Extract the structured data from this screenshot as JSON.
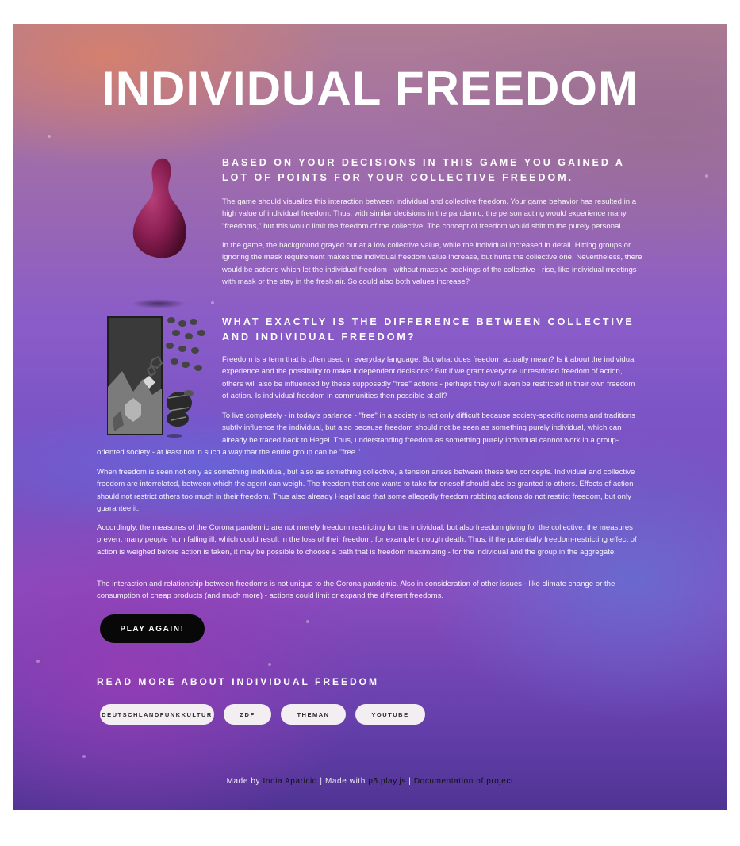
{
  "page": {
    "title": "INDIVIDUAL FREEDOM"
  },
  "section1": {
    "heading": "BASED ON YOUR DECISIONS IN THIS GAME YOU GAINED A LOT OF POINTS FOR YOUR COLLECTIVE FREEDOM.",
    "paragraphs": [
      "The game should visualize this interaction between individual and collective freedom. Your game behavior has resulted in a high value of individual freedom. Thus, with similar decisions in the pandemic, the person acting would experience many \"freedoms,\" but this would limit the freedom of the collective. The concept of freedom would shift to the purely personal.",
      "In the game, the background grayed out at a low collective value, while the individual increased in detail. Hitting groups or ignoring the mask requirement makes the individual freedom value increase, but hurts the collective one. Nevertheless, there would be actions which let the individual freedom - without massive bookings of the collective - rise, like individual meetings with mask or the stay in the fresh air. So could also both values increase?"
    ]
  },
  "section2": {
    "heading": "WHAT EXACTLY IS THE DIFFERENCE BETWEEN COLLECTIVE AND INDIVIDUAL FREEDOM?",
    "paragraphs": [
      "Freedom is a term that is often used in everyday language. But what does freedom actually mean? Is it about the individual experience and the possibility to make independent decisions? But if we grant everyone unrestricted freedom of action, others will also be influenced by these supposedly \"free\" actions - perhaps they will even be restricted in their own freedom of action. Is individual freedom in communities then possible at all?",
      "To live completely - in today's parlance - \"free\" in a society is not only difficult because society-specific norms and traditions subtly influence the individual, but also because freedom should not be seen as something purely individual, which can already be traced back to Hegel. Thus, understanding freedom as something purely individual cannot work in a group-",
      "oriented society - at least not in such a way that the entire group can be \"free.\"",
      "When freedom is seen not only as something individual, but also as something collective, a tension arises between these two concepts. Individual and collective freedom are interrelated, between which the agent can weigh. The freedom that one wants to take for oneself should also be granted to others. Effects of action should not restrict others too much in their freedom. Thus also already Hegel said that some allegedly freedom robbing actions do not restrict freedom, but only guarantee it.",
      "Accordingly, the measures of the Corona pandemic are not merely freedom restricting for the individual, but also freedom giving for the collective: the measures prevent many people from falling ill, which could result in the loss of their freedom, for example through death. Thus, if the potentially freedom-restricting effect of action is weighed before action is taken, it may be possible to choose a path that is freedom maximizing - for the individual and the group in the aggregate.",
      "The interaction and relationship between freedoms is not unique to the Corona pandemic. Also in consideration of other issues - like climate change or the consumption of cheap products (and much more) - actions could limit or expand the different freedoms."
    ]
  },
  "actions": {
    "play_again": "PLAY AGAIN!"
  },
  "read_more": {
    "heading": "READ MORE ABOUT INDIVIDUAL FREEDOM",
    "links": [
      "DEUTSCHLANDFUNKKULTUR",
      "ZDF",
      "THEMAN",
      "YOUTUBE"
    ]
  },
  "footer": {
    "made_by_prefix": "Made by",
    "author": "India Aparicio",
    "sep1": "|",
    "made_with_prefix": "Made with",
    "library": "p5.play.js",
    "sep2": "|",
    "documentation": "Documentation of project"
  },
  "colors": {
    "accent_button": "#080808",
    "pill_bg": "#f2eef2",
    "figure": "#8a1e52"
  }
}
